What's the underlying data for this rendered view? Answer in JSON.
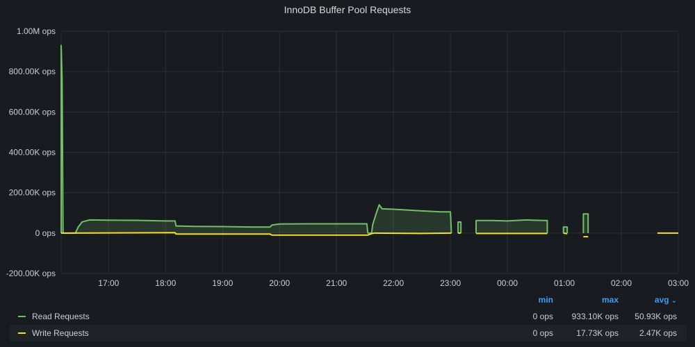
{
  "panel": {
    "title": "InnoDB Buffer Pool Requests"
  },
  "legend": {
    "headers": {
      "min": "min",
      "max": "max",
      "avg": "avg"
    },
    "sort_icon": "chevron-down-icon",
    "rows": [
      {
        "name": "Read Requests",
        "color": "#73bf69",
        "min": "0 ops",
        "max": "933.10K ops",
        "avg": "50.93K ops"
      },
      {
        "name": "Write Requests",
        "color": "#fade2a",
        "min": "0 ops",
        "max": "17.73K ops",
        "avg": "2.47K ops"
      }
    ]
  },
  "chart_data": {
    "type": "area",
    "title": "InnoDB Buffer Pool Requests",
    "y_unit": "ops",
    "ylim": [
      -200000,
      1000000
    ],
    "y_ticks": [
      -200000,
      0,
      200000,
      400000,
      600000,
      800000,
      1000000
    ],
    "y_tick_labels": [
      "-200.00K ops",
      "0 ops",
      "200.00K ops",
      "400.00K ops",
      "600.00K ops",
      "800.00K ops",
      "1.00M ops"
    ],
    "xlim": [
      "16:10",
      "03:00"
    ],
    "x_ticks": [
      "17:00",
      "18:00",
      "19:00",
      "20:00",
      "21:00",
      "22:00",
      "23:00",
      "00:00",
      "01:00",
      "02:00",
      "03:00"
    ],
    "grid": true,
    "legend_position": "bottom",
    "series": [
      {
        "name": "Read Requests",
        "color": "#73bf69",
        "segments": [
          [
            [
              "16:10",
              0
            ],
            [
              "16:10",
              930000
            ],
            [
              "16:11",
              760000
            ],
            [
              "16:12",
              0
            ],
            [
              "16:25",
              0
            ],
            [
              "16:28",
              30000
            ],
            [
              "16:32",
              55000
            ],
            [
              "16:40",
              65000
            ],
            [
              "17:00",
              64000
            ],
            [
              "17:30",
              63000
            ],
            [
              "18:00",
              60000
            ],
            [
              "18:10",
              60000
            ],
            [
              "18:11",
              35000
            ],
            [
              "18:30",
              33000
            ],
            [
              "19:00",
              32000
            ],
            [
              "19:30",
              30000
            ],
            [
              "19:50",
              30000
            ],
            [
              "19:52",
              40000
            ],
            [
              "20:00",
              45000
            ],
            [
              "20:30",
              46000
            ],
            [
              "21:00",
              46000
            ],
            [
              "21:32",
              46000
            ],
            [
              "21:33",
              0
            ],
            [
              "21:37",
              0
            ],
            [
              "21:38",
              40000
            ],
            [
              "21:42",
              100000
            ],
            [
              "21:45",
              140000
            ],
            [
              "21:48",
              120000
            ],
            [
              "22:00",
              118000
            ],
            [
              "22:30",
              110000
            ],
            [
              "22:50",
              105000
            ],
            [
              "23:00",
              105000
            ],
            [
              "23:01",
              0
            ]
          ],
          [
            [
              "23:08",
              0
            ],
            [
              "23:08",
              55000
            ],
            [
              "23:11",
              55000
            ],
            [
              "23:11",
              0
            ]
          ],
          [
            [
              "23:27",
              0
            ],
            [
              "23:27",
              62000
            ],
            [
              "23:45",
              62000
            ],
            [
              "00:00",
              60000
            ],
            [
              "00:20",
              65000
            ],
            [
              "00:40",
              62000
            ],
            [
              "00:42",
              62000
            ],
            [
              "00:42",
              0
            ]
          ],
          [
            [
              "00:59",
              0
            ],
            [
              "00:59",
              30000
            ],
            [
              "01:03",
              30000
            ],
            [
              "01:03",
              0
            ]
          ],
          [
            [
              "01:20",
              0
            ],
            [
              "01:20",
              95000
            ],
            [
              "01:25",
              95000
            ],
            [
              "01:25",
              0
            ]
          ]
        ]
      },
      {
        "name": "Write Requests",
        "color": "#fade2a",
        "segments": [
          [
            [
              "16:10",
              0
            ],
            [
              "18:10",
              2000
            ],
            [
              "18:11",
              -5000
            ],
            [
              "19:50",
              -5000
            ],
            [
              "19:52",
              -10000
            ],
            [
              "21:33",
              -10000
            ],
            [
              "21:37",
              -3000
            ],
            [
              "21:40",
              0
            ],
            [
              "22:30",
              -2000
            ],
            [
              "23:01",
              0
            ]
          ],
          [
            [
              "23:08",
              0
            ],
            [
              "23:11",
              0
            ]
          ],
          [
            [
              "23:27",
              -2000
            ],
            [
              "00:42",
              -2000
            ]
          ],
          [
            [
              "00:59",
              0
            ],
            [
              "01:03",
              -3000
            ]
          ],
          [
            [
              "01:20",
              -18000
            ],
            [
              "01:25",
              -18000
            ]
          ],
          [
            [
              "02:38",
              0
            ],
            [
              "03:00",
              0
            ]
          ]
        ]
      }
    ]
  }
}
